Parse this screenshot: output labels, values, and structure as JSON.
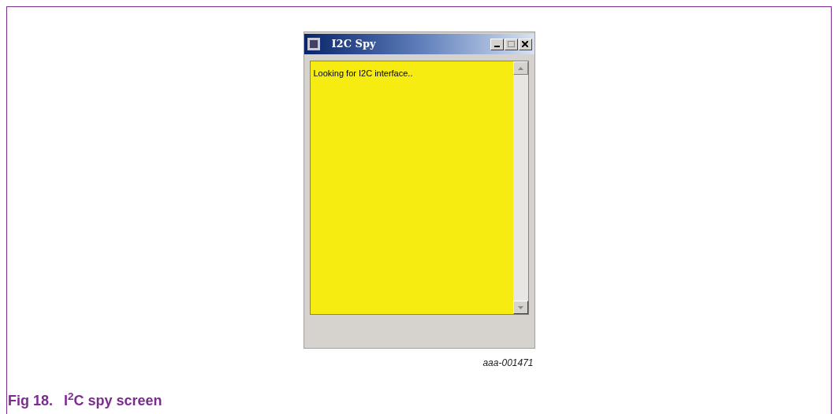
{
  "window": {
    "title": "I2C Spy",
    "log_text": "Looking for I2C interface.."
  },
  "figure_id": "aaa-001471",
  "caption": {
    "number": "Fig 18.",
    "title": "I$^{2}$C spy screen"
  }
}
